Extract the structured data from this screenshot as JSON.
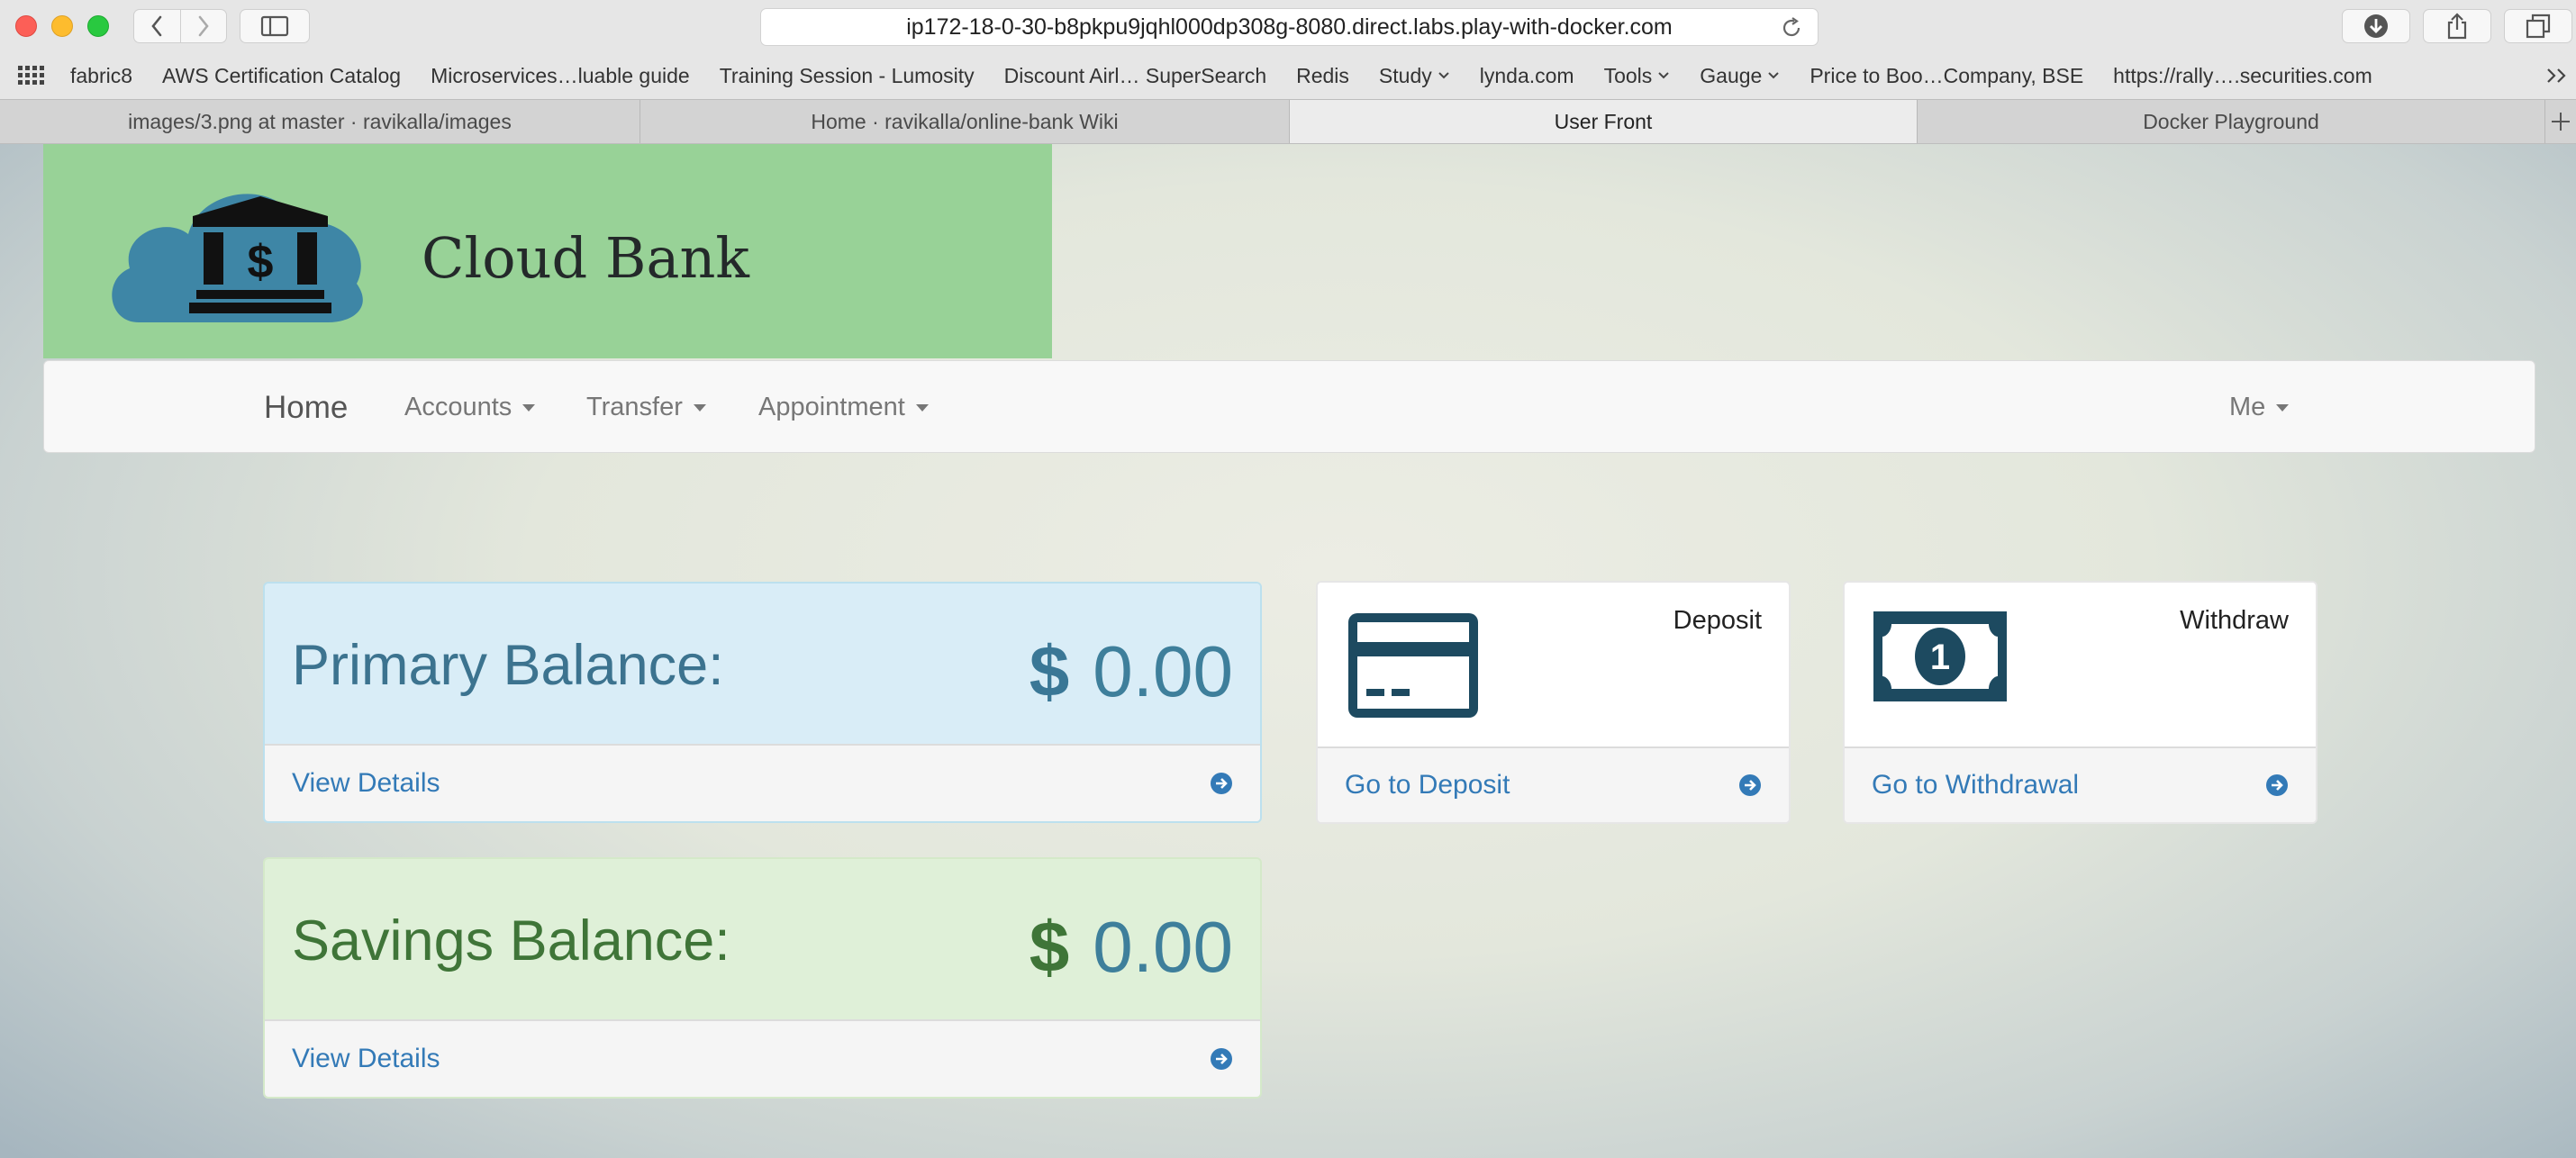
{
  "browser": {
    "url": "ip172-18-0-30-b8pkpu9jqhl000dp308g-8080.direct.labs.play-with-docker.com",
    "bookmarks": [
      "fabric8",
      "AWS Certification Catalog",
      "Microservices…luable guide",
      "Training Session - Lumosity",
      "Discount Airl… SuperSearch",
      "Redis",
      "Study",
      "lynda.com",
      "Tools",
      "Gauge",
      "Price to Boo…Company, BSE",
      "https://rally….securities.com"
    ],
    "tabs": [
      {
        "label": "images/3.png at master · ravikalla/images",
        "active": false
      },
      {
        "label": "Home · ravikalla/online-bank Wiki",
        "active": false
      },
      {
        "label": "User Front",
        "active": true
      },
      {
        "label": "Docker Playground",
        "active": false
      }
    ]
  },
  "brand": {
    "name": "Cloud Bank",
    "colors": {
      "logo_bg": "#98d297",
      "logo_cloud": "#3e86a6",
      "primary": "#337ab7"
    }
  },
  "nav": {
    "home": "Home",
    "accounts": "Accounts",
    "transfer": "Transfer",
    "appointment": "Appointment",
    "me": "Me"
  },
  "primary_balance": {
    "label": "Primary Balance:",
    "currency": "$",
    "amount": "0.00",
    "link": "View Details"
  },
  "savings_balance": {
    "label": "Savings Balance:",
    "currency": "$",
    "amount": "0.00",
    "link": "View Details"
  },
  "deposit": {
    "title": "Deposit",
    "link": "Go to Deposit",
    "icon": "credit-card-icon"
  },
  "withdraw": {
    "title": "Withdraw",
    "link": "Go to Withdrawal",
    "icon": "money-bill-icon"
  }
}
